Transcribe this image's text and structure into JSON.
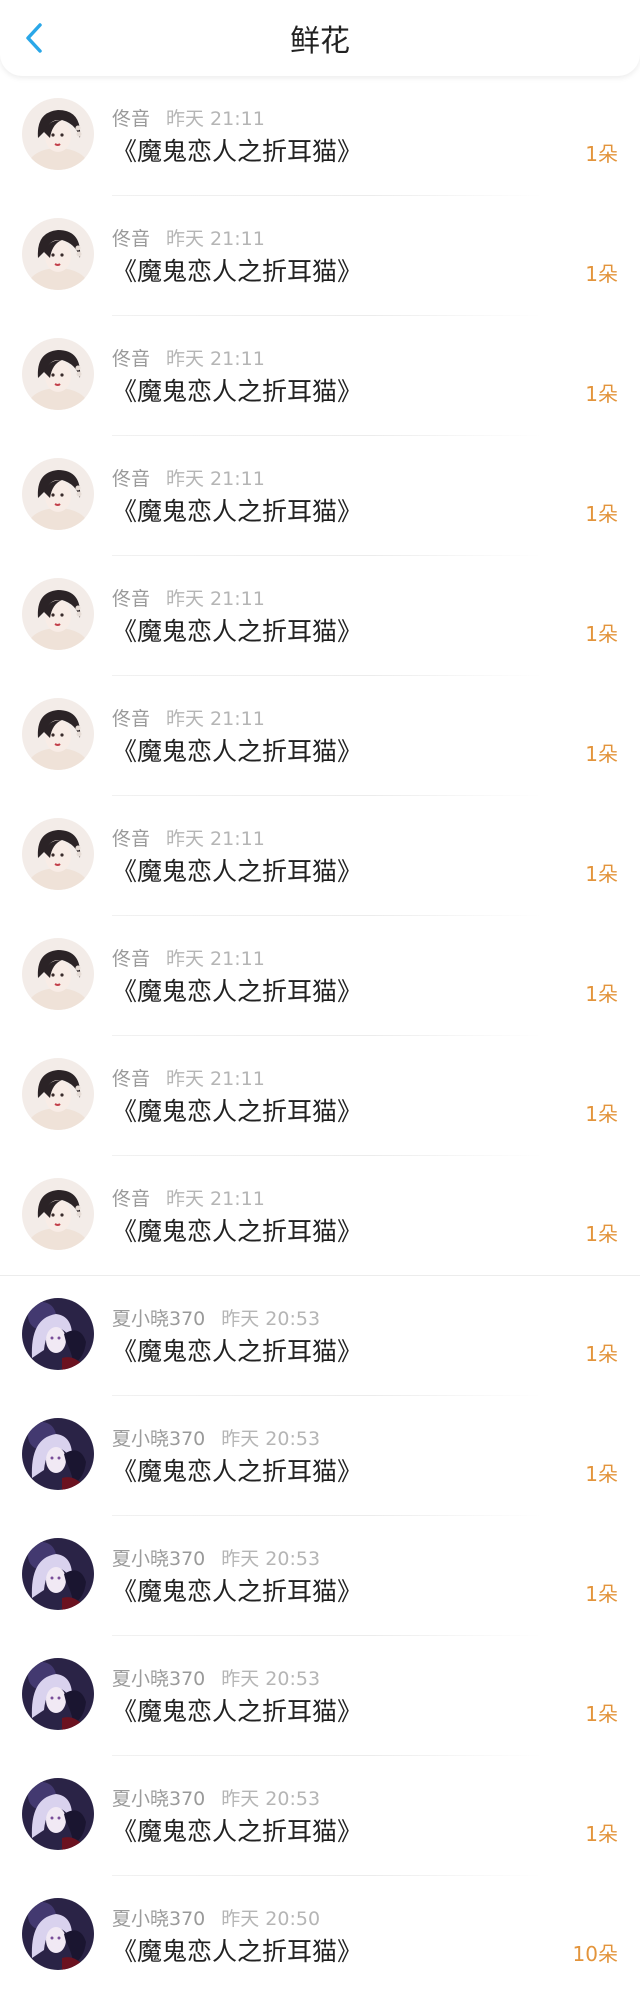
{
  "header": {
    "title": "鲜花",
    "back_icon": "chevron-left-icon",
    "accent": "#2aa7e8"
  },
  "colors": {
    "count": "#e3943b",
    "name": "#9a9a9a",
    "time": "#b5b5b5",
    "book": "#222222"
  },
  "gifts": [
    {
      "user": "佟音",
      "time": "昨天 21:11",
      "book": "《魔鬼恋人之折耳猫》",
      "count": "1朵",
      "avatar": "avatar-girl-light"
    },
    {
      "user": "佟音",
      "time": "昨天 21:11",
      "book": "《魔鬼恋人之折耳猫》",
      "count": "1朵",
      "avatar": "avatar-girl-light"
    },
    {
      "user": "佟音",
      "time": "昨天 21:11",
      "book": "《魔鬼恋人之折耳猫》",
      "count": "1朵",
      "avatar": "avatar-girl-light"
    },
    {
      "user": "佟音",
      "time": "昨天 21:11",
      "book": "《魔鬼恋人之折耳猫》",
      "count": "1朵",
      "avatar": "avatar-girl-light"
    },
    {
      "user": "佟音",
      "time": "昨天 21:11",
      "book": "《魔鬼恋人之折耳猫》",
      "count": "1朵",
      "avatar": "avatar-girl-light"
    },
    {
      "user": "佟音",
      "time": "昨天 21:11",
      "book": "《魔鬼恋人之折耳猫》",
      "count": "1朵",
      "avatar": "avatar-girl-light"
    },
    {
      "user": "佟音",
      "time": "昨天 21:11",
      "book": "《魔鬼恋人之折耳猫》",
      "count": "1朵",
      "avatar": "avatar-girl-light"
    },
    {
      "user": "佟音",
      "time": "昨天 21:11",
      "book": "《魔鬼恋人之折耳猫》",
      "count": "1朵",
      "avatar": "avatar-girl-light"
    },
    {
      "user": "佟音",
      "time": "昨天 21:11",
      "book": "《魔鬼恋人之折耳猫》",
      "count": "1朵",
      "avatar": "avatar-girl-light"
    },
    {
      "user": "佟音",
      "time": "昨天 21:11",
      "book": "《魔鬼恋人之折耳猫》",
      "count": "1朵",
      "avatar": "avatar-girl-light"
    },
    {
      "user": "夏小晓370",
      "time": "昨天 20:53",
      "book": "《魔鬼恋人之折耳猫》",
      "count": "1朵",
      "avatar": "avatar-anime-dark"
    },
    {
      "user": "夏小晓370",
      "time": "昨天 20:53",
      "book": "《魔鬼恋人之折耳猫》",
      "count": "1朵",
      "avatar": "avatar-anime-dark"
    },
    {
      "user": "夏小晓370",
      "time": "昨天 20:53",
      "book": "《魔鬼恋人之折耳猫》",
      "count": "1朵",
      "avatar": "avatar-anime-dark"
    },
    {
      "user": "夏小晓370",
      "time": "昨天 20:53",
      "book": "《魔鬼恋人之折耳猫》",
      "count": "1朵",
      "avatar": "avatar-anime-dark"
    },
    {
      "user": "夏小晓370",
      "time": "昨天 20:53",
      "book": "《魔鬼恋人之折耳猫》",
      "count": "1朵",
      "avatar": "avatar-anime-dark"
    },
    {
      "user": "夏小晓370",
      "time": "昨天 20:50",
      "book": "《魔鬼恋人之折耳猫》",
      "count": "10朵",
      "avatar": "avatar-anime-dark"
    }
  ]
}
